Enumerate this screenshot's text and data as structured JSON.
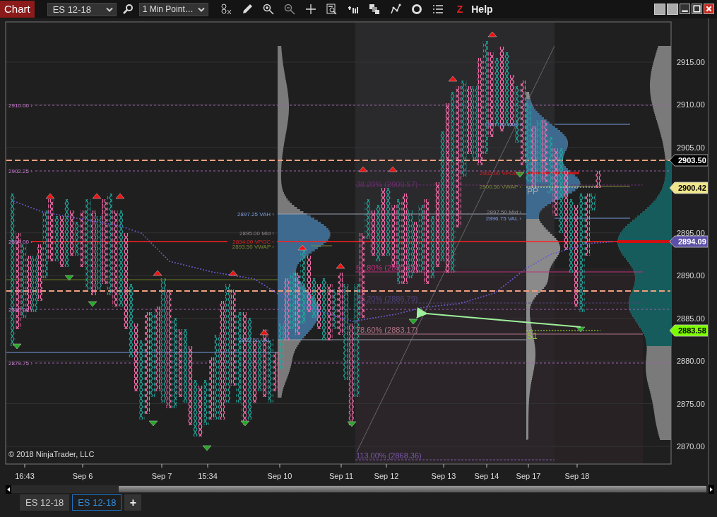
{
  "toolbar": {
    "title": "Chart",
    "instrument": "ES 12-18",
    "interval": "1 Min Point…",
    "z": "Z",
    "help": "Help"
  },
  "chart": {
    "level_labels": [
      "2910.00 ›",
      "2902.25 ›",
      "2894.00 ›",
      "2886.00 ›",
      "2879.75 ›"
    ],
    "profile_labels": [
      {
        "text": "2897.25 VAH ›",
        "kind": "vah"
      },
      {
        "text": "2895.00 Mid ›",
        "kind": "mid"
      },
      {
        "text": "2894.00 VPOC ›",
        "kind": "vpoc"
      },
      {
        "text": "2893.50 VWAP ›",
        "kind": "vwap"
      },
      {
        "text": "2882.50 VAL ›",
        "kind": "val"
      },
      {
        "text": "2907.75 VAH ›",
        "kind": "vah"
      },
      {
        "text": "2902.00 VPOC ›",
        "kind": "vpoc"
      },
      {
        "text": "2900.50 VWAP ›",
        "kind": "vwap"
      },
      {
        "text": "2897.50 Mid ›",
        "kind": "mid"
      },
      {
        "text": "2896.75 VAL ›",
        "kind": "val"
      }
    ],
    "fib_labels": [
      {
        "text": "38.20% (2900.57)",
        "color": "#6a2f6e"
      },
      {
        "text": "61.80% (2890.41)",
        "color": "#b8327a"
      },
      {
        "text": "70.20% (2886.79)",
        "color": "#4f4478"
      },
      {
        "text": "78.60% (2883.17)",
        "color": "#b07585"
      },
      {
        "text": "113.00% (2868.36)",
        "color": "#7a5aa8"
      }
    ],
    "pivot_labels": [
      "PP",
      "S1"
    ],
    "copyright": "© 2018 NinjaTrader, LLC",
    "price_ticks": [
      "2915.00",
      "2910.00",
      "2905.00",
      "2895.00",
      "2890.00",
      "2885.00",
      "2880.00",
      "2875.00",
      "2870.00"
    ],
    "price_markers": [
      {
        "text": "2903.50",
        "color": "#000000"
      },
      {
        "text": "2900.42",
        "color": "#f0e68c"
      },
      {
        "text": "2894.09",
        "color": "#5b4fa8"
      },
      {
        "text": "2883.58",
        "color": "#7cfc00"
      }
    ],
    "time_labels": [
      "16:43",
      "Sep 6",
      "Sep 7",
      "15:34",
      "Sep 10",
      "Sep 11",
      "Sep 12",
      "Sep 13",
      "Sep 14",
      "Sep 17",
      "Sep 18"
    ]
  },
  "tabs": [
    {
      "label": "ES 12-18",
      "selected": false
    },
    {
      "label": "ES 12-18",
      "selected": true
    }
  ],
  "add_tab": "+"
}
